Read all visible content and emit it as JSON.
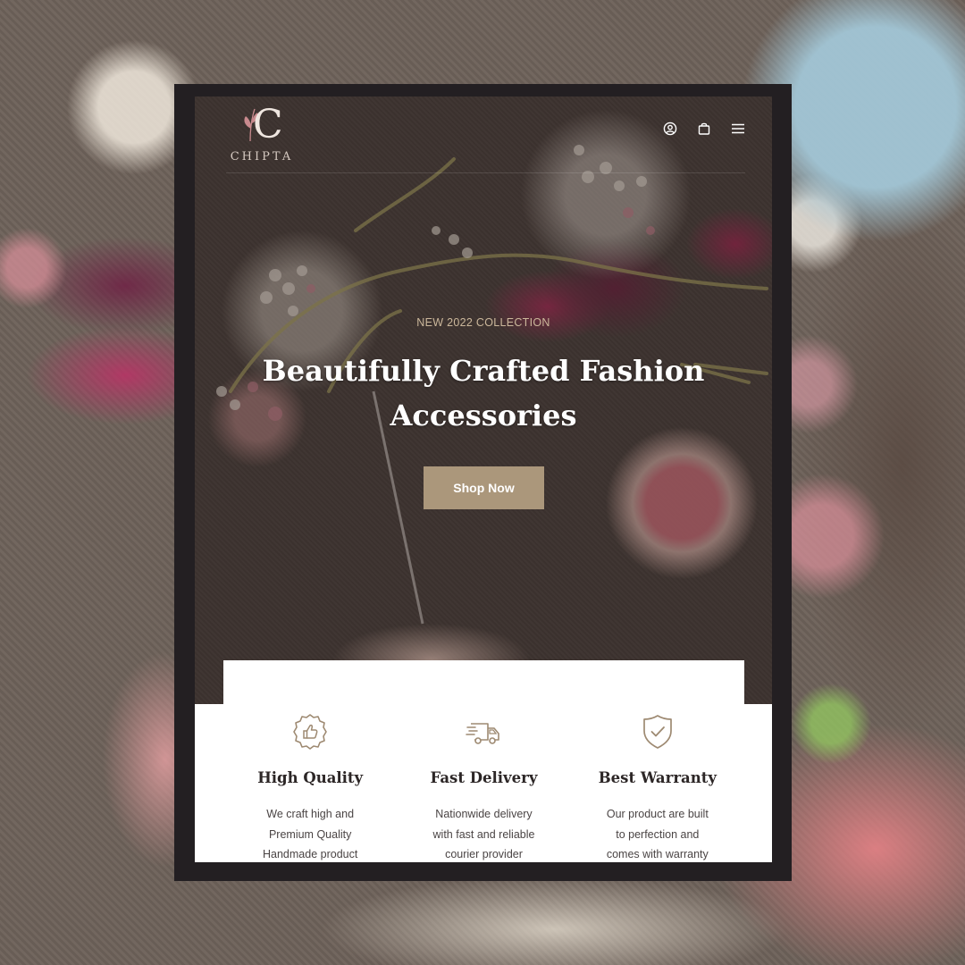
{
  "brand": {
    "name": "CHIPTA",
    "monogram": "C"
  },
  "header": {
    "icons": [
      "user-icon",
      "bag-icon",
      "menu-icon"
    ]
  },
  "hero": {
    "eyebrow": "NEW 2022 COLLECTION",
    "headline": "Beautifully Crafted Fashion Accessories",
    "cta_label": "Shop Now"
  },
  "features": [
    {
      "icon": "thumbs-up-badge-icon",
      "title": "High Quality",
      "desc": "We craft high and Premium Quality Handmade product"
    },
    {
      "icon": "delivery-truck-icon",
      "title": "Fast Delivery",
      "desc": "Nationwide delivery with fast and reliable courier provider"
    },
    {
      "icon": "shield-check-icon",
      "title": "Best Warranty",
      "desc": "Our product are built to perfection and comes with warranty"
    }
  ],
  "colors": {
    "accent": "#ab977b",
    "eyebrow": "#cbb79b",
    "frame": "#231f22",
    "hero_bg": "#4a3f3b",
    "icon_stroke": "#9e8a72",
    "heading_text": "#2c2626"
  }
}
